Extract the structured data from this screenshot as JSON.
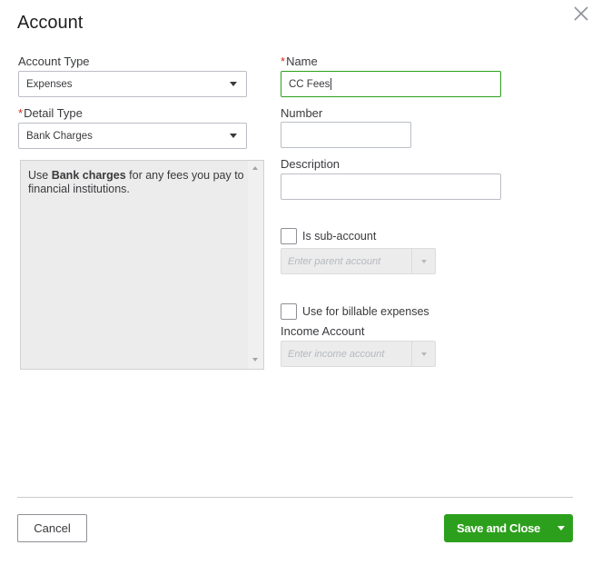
{
  "dialog": {
    "title": "Account",
    "close_icon": "close-icon"
  },
  "left": {
    "account_type": {
      "label": "Account Type",
      "value": "Expenses"
    },
    "detail_type": {
      "label": "Detail Type",
      "required_mark": "*",
      "value": "Bank Charges"
    },
    "help_text": {
      "prefix": "Use ",
      "bold": "Bank charges",
      "suffix": " for any fees you pay to financial institutions."
    }
  },
  "right": {
    "name": {
      "label": "Name",
      "required_mark": "*",
      "value": "CC Fees"
    },
    "number": {
      "label": "Number",
      "value": ""
    },
    "description": {
      "label": "Description",
      "value": ""
    },
    "sub_account": {
      "label": "Is sub-account",
      "checked": false,
      "placeholder": "Enter parent account"
    },
    "billable": {
      "label": "Use for billable expenses",
      "checked": false
    },
    "income_account": {
      "label": "Income Account",
      "placeholder": "Enter income account"
    }
  },
  "footer": {
    "cancel_label": "Cancel",
    "save_label": "Save and Close"
  },
  "colors": {
    "accent_green": "#2ca01c",
    "required_red": "#d52b1e"
  }
}
